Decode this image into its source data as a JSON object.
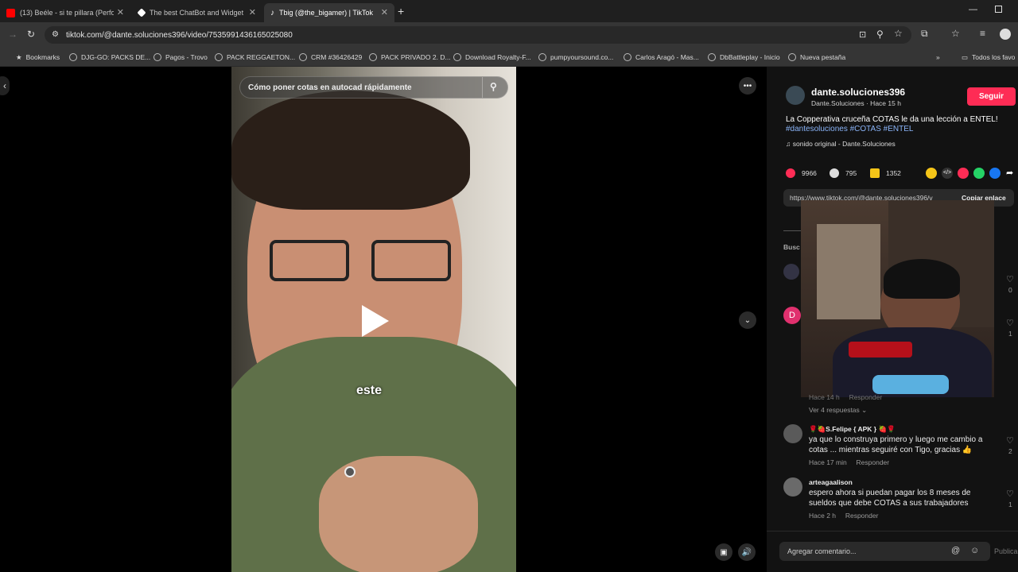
{
  "tabs": [
    {
      "label": "(13) Beéle - si te pillara (Perform",
      "favicon_color": "#ff0000"
    },
    {
      "label": "The best ChatBot and Widgets",
      "favicon_color": "#ffffff"
    },
    {
      "label": "Tbig (@the_bigamer) | TikTok",
      "favicon_color": "#ffffff"
    }
  ],
  "new_tab": "+",
  "address": {
    "url": "tiktok.com/@dante.soluciones396/video/7535991436165025080"
  },
  "bookmarks": [
    "Bookmarks",
    "DJG-GO: PACKS DE...",
    "Pagos - Trovo",
    "PACK REGGAETON...",
    "CRM #36426429",
    "PACK PRIVADO 2. D...",
    "Download Royalty-F...",
    "pumpyoursound.co...",
    "Carlos Aragó - Mas...",
    "DbBattleplay - Inicio",
    "Nueva pestaña"
  ],
  "bookmarks_more": "»",
  "all_bookmarks": "Todos los favo",
  "video": {
    "search_text": "Cómo poner cotas en autocad rápidamente",
    "caption": "este"
  },
  "post": {
    "username": "dante.soluciones396",
    "display_line": "Dante.Soluciones · Hace 15 h",
    "follow_label": "Seguir",
    "description": "La Copperativa cruceña COTAS le da una lección a ENTEL!",
    "hashtags": "#dantesoluciones #COTAS #ENTEL",
    "sound": "sonido original - Dante.Soluciones",
    "likes": "9966",
    "comments": "795",
    "saves": "1352",
    "link_text": "https://www.tiktok.com/@dante.soluciones396/v",
    "copy_link": "Copiar enlace",
    "search_hint": "Busc"
  },
  "comments": [
    {
      "avatar_letter": "D",
      "likes": "0"
    },
    {
      "likes": "1"
    },
    {
      "meta_time": "Hace 14 h",
      "meta_reply": "Responder",
      "view_replies": "Ver 4 respuestas"
    },
    {
      "name": "🌹🍓S.Felipe { APK } 🍓🌹",
      "text": "ya que lo construya primero y luego me cambio a cotas ... mientras seguiré con Tigo, gracias 👍",
      "time": "Hace 17 min",
      "reply": "Responder",
      "likes": "2"
    },
    {
      "name": "arteagaalison",
      "text": "espero ahora si puedan pagar los 8 meses de sueldos que debe COTAS a sus trabajadores",
      "time": "Hace 2 h",
      "reply": "Responder",
      "likes": "1"
    }
  ],
  "comment_input": {
    "placeholder": "Agregar comentario...",
    "post_label": "Publica"
  },
  "colors": {
    "accent": "#fe2c55",
    "hashtag": "#8ab4f8"
  }
}
